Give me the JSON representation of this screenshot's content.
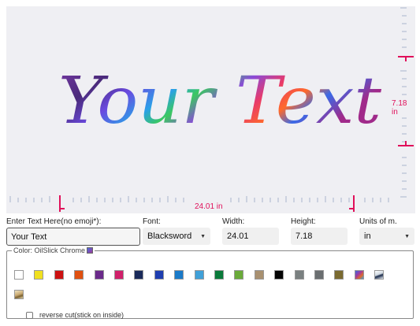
{
  "preview": {
    "sample_text": "Your Text",
    "width_readout": "24.01 in",
    "height_readout": "7.18 in"
  },
  "form": {
    "text_label": "Enter Text Here(no emoji*):",
    "text_value": "Your Text",
    "font_label": "Font:",
    "font_value": "Blacksword",
    "width_label": "Width:",
    "width_value": "24.01",
    "height_label": "Height:",
    "height_value": "7.18",
    "units_label": "Units of m.",
    "units_value": "in"
  },
  "color": {
    "legend": "Color: OilSlick Chrome",
    "swatches": [
      {
        "name": "white",
        "color": "#ffffff"
      },
      {
        "name": "yellow",
        "color": "#f0e020"
      },
      {
        "name": "red",
        "color": "#cc1111"
      },
      {
        "name": "orange",
        "color": "#e05010"
      },
      {
        "name": "purple",
        "color": "#6a2a8a"
      },
      {
        "name": "magenta",
        "color": "#d0206a"
      },
      {
        "name": "navy",
        "color": "#1a2a5a"
      },
      {
        "name": "blue",
        "color": "#1e3eb0"
      },
      {
        "name": "medium-blue",
        "color": "#1a7ac8"
      },
      {
        "name": "light-blue",
        "color": "#40a0d8"
      },
      {
        "name": "green",
        "color": "#0a7a3a"
      },
      {
        "name": "lime-green",
        "color": "#6aaa3a"
      },
      {
        "name": "tan",
        "color": "#a89070"
      },
      {
        "name": "black",
        "color": "#050505"
      },
      {
        "name": "gray",
        "color": "#7a8080"
      },
      {
        "name": "dark-gray",
        "color": "#6a6e70"
      },
      {
        "name": "olive-brown",
        "color": "#7a6a30"
      },
      {
        "name": "oilslick-chrome",
        "color": "#6a4aa0"
      },
      {
        "name": "chrome-silver",
        "color": "#d0d8e0"
      },
      {
        "name": "gold-chrome",
        "color": "#c8b080"
      }
    ],
    "reverse_cut_label": "reverse cut(stick on inside)"
  }
}
